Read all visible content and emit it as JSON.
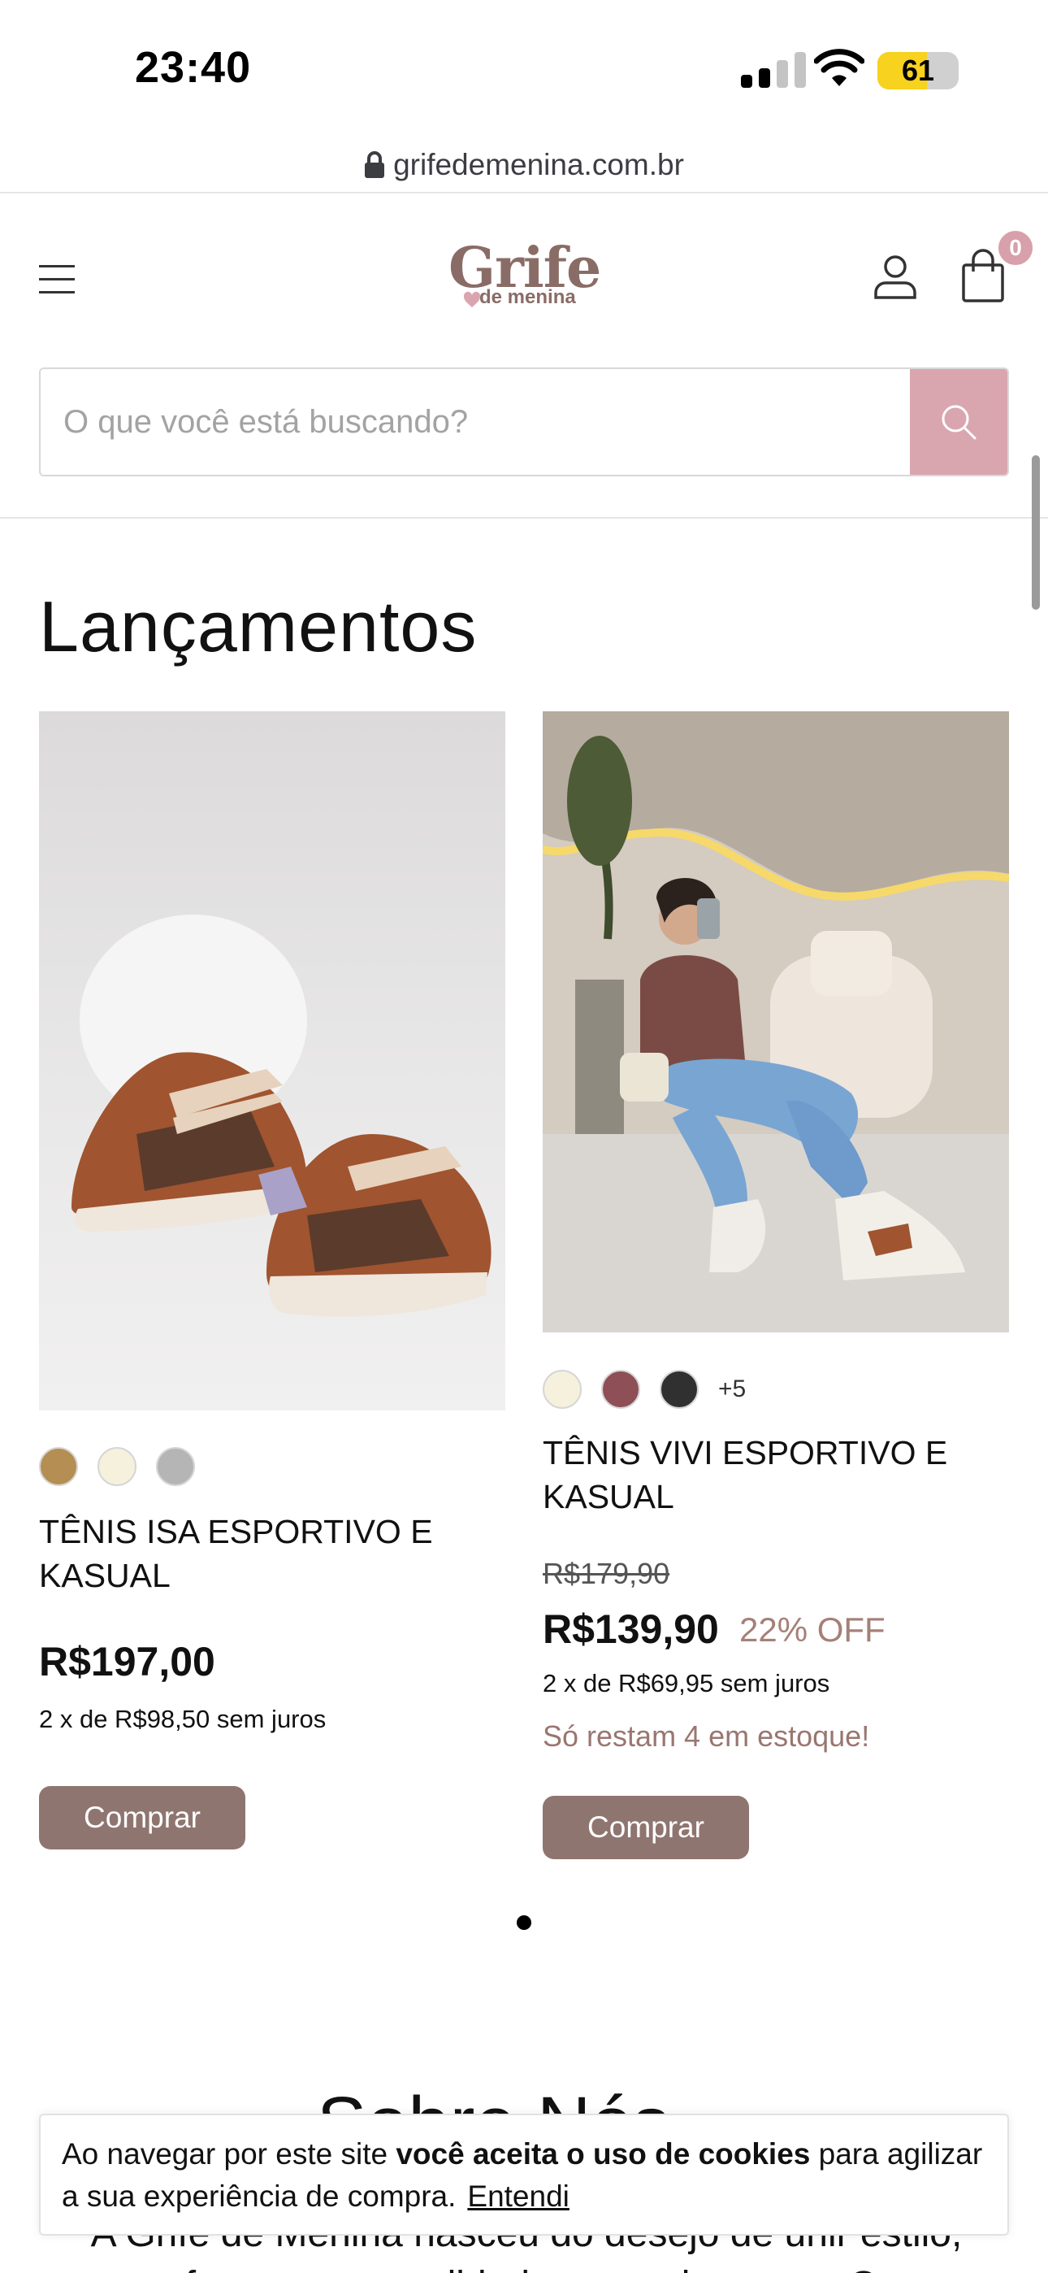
{
  "status_bar": {
    "time": "23:40",
    "battery": "61",
    "battery_level": 0.61
  },
  "browser": {
    "url": "grifedemenina.com.br"
  },
  "header": {
    "logo_main": "Grife",
    "logo_sub": "de menina",
    "cart_count": "0"
  },
  "search": {
    "placeholder": "O que você está buscando?"
  },
  "section": {
    "title": "Lançamentos"
  },
  "products": [
    {
      "name": "TÊNIS ISA ESPORTIVO E KASUAL",
      "price": "R$197,00",
      "installments": "2 x de R$98,50 sem juros",
      "button": "Comprar",
      "swatches": [
        "#b48e52",
        "#f6f1dc",
        "#b5b5b5"
      ]
    },
    {
      "name": "TÊNIS VIVI ESPORTIVO E KASUAL",
      "old_price": "R$179,90",
      "price": "R$139,90",
      "discount": "22% OFF",
      "installments": "2 x de R$69,95 sem juros",
      "stock": "Só restam 4 em estoque!",
      "button": "Comprar",
      "swatches": [
        "#f6f1dc",
        "#8e4f57",
        "#303030"
      ],
      "more_colors": "+5"
    }
  ],
  "about": {
    "title": "Sobre Nós",
    "text": "A Grife de Menina nasceu do desejo de unir estilo, conforto e personalidade em cada passo. Com"
  },
  "cookie": {
    "text_before": "Ao navegar por este site ",
    "text_bold": "você aceita o uso de cookies",
    "text_after": " para agilizar a sua experiência de compra.",
    "link": "Entendi"
  },
  "colors": {
    "accent_pink": "#d9a6b0",
    "button_brown": "#8f7570",
    "logo_brown": "#8a6c66",
    "discount_text": "#a58077"
  }
}
